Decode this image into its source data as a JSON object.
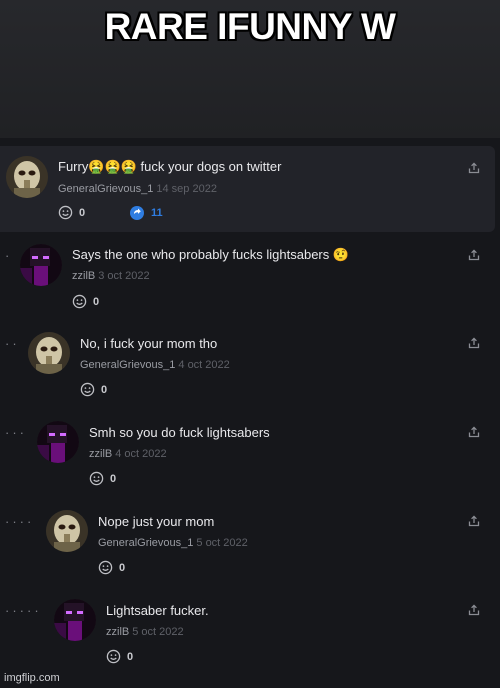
{
  "caption": "RARE IFUNNY W",
  "watermark": "imgflip.com",
  "colors": {
    "background": "#16171b",
    "highlight": "#222329",
    "reply_accent": "#2f7de1",
    "text": "#e9e9ec",
    "username": "#9a9ca3",
    "date": "#5f6168"
  },
  "comments": [
    {
      "depth": 0,
      "avatar": "general-grievous-avatar",
      "text_before": "Furry",
      "emoji": "🤮🤮🤮",
      "text_after": " fuck your dogs on twitter",
      "username": "GeneralGrievous_1",
      "date": "14 sep 2022",
      "smiles": "0",
      "replies": "11"
    },
    {
      "depth": 1,
      "avatar": "enderman-avatar",
      "text_before": "Says the one who probably fucks lightsabers ",
      "emoji": "🤨",
      "text_after": "",
      "username": "zzilB",
      "date": "3 oct 2022",
      "smiles": "0"
    },
    {
      "depth": 2,
      "avatar": "general-grievous-avatar",
      "text_before": "No, i fuck your mom tho",
      "emoji": "",
      "text_after": "",
      "username": "GeneralGrievous_1",
      "date": "4 oct 2022",
      "smiles": "0"
    },
    {
      "depth": 3,
      "avatar": "enderman-avatar",
      "text_before": "Smh so you do fuck lightsabers",
      "emoji": "",
      "text_after": "",
      "username": "zzilB",
      "date": "4 oct 2022",
      "smiles": "0"
    },
    {
      "depth": 4,
      "avatar": "general-grievous-avatar",
      "text_before": "Nope just your mom",
      "emoji": "",
      "text_after": "",
      "username": "GeneralGrievous_1",
      "date": "5 oct 2022",
      "smiles": "0"
    },
    {
      "depth": 5,
      "avatar": "enderman-avatar",
      "text_before": "Lightsaber fucker.",
      "emoji": "",
      "text_after": "",
      "username": "zzilB",
      "date": "5 oct 2022",
      "smiles": "0"
    }
  ],
  "icons": {
    "share": "share-icon",
    "smile": "smile-icon",
    "replies": "reply-bubble-icon"
  }
}
